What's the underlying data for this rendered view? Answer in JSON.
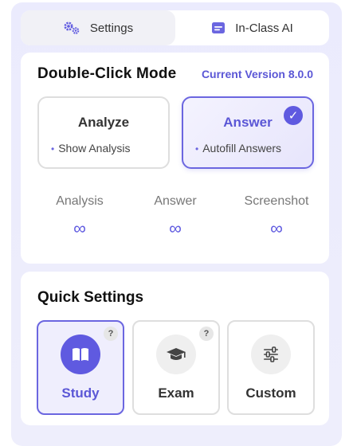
{
  "tabs": [
    {
      "label": "Settings",
      "icon": "gears-icon",
      "active": true
    },
    {
      "label": "In-Class AI",
      "icon": "ai-window-icon",
      "active": false
    }
  ],
  "double_click": {
    "title": "Double-Click Mode",
    "version": "Current Version 8.0.0",
    "modes": [
      {
        "title": "Analyze",
        "feature": "Show Analysis",
        "selected": false
      },
      {
        "title": "Answer",
        "feature": "Autofill Answers",
        "selected": true
      }
    ],
    "stats": [
      {
        "label": "Analysis",
        "value": "∞"
      },
      {
        "label": "Answer",
        "value": "∞"
      },
      {
        "label": "Screenshot",
        "value": "∞"
      }
    ],
    "check_mark": "✓",
    "bullet": "•"
  },
  "quick_settings": {
    "title": "Quick Settings",
    "options": [
      {
        "label": "Study",
        "icon": "book-icon",
        "selected": true,
        "help": "?"
      },
      {
        "label": "Exam",
        "icon": "graduation-cap-icon",
        "selected": false,
        "help": "?"
      },
      {
        "label": "Custom",
        "icon": "sliders-icon",
        "selected": false
      }
    ]
  },
  "colors": {
    "accent": "#5f5ae0",
    "panel_bg": "#ebebfd",
    "card_bg": "#ffffff",
    "border": "#dedede"
  }
}
